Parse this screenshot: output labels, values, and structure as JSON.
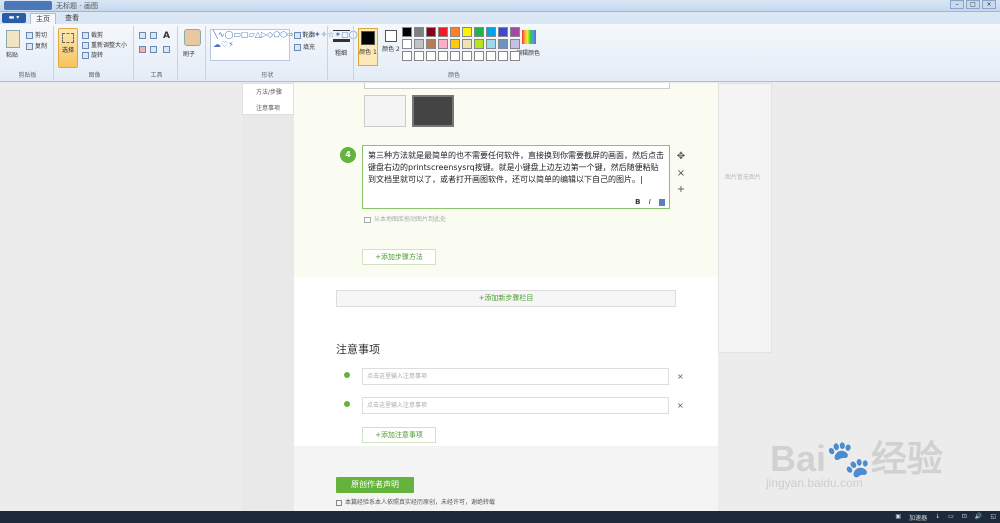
{
  "window": {
    "title": "无标题 - 画图"
  },
  "tabs": {
    "file": "▬ ▾",
    "home": "主页",
    "view": "查看"
  },
  "ribbon": {
    "clipboard": {
      "paste": "粘贴",
      "cut": "剪切",
      "copy": "复制",
      "label": "剪贴板"
    },
    "image": {
      "select": "选择",
      "crop": "裁剪",
      "resize": "重新调整大小",
      "rotate": "旋转",
      "label": "图像"
    },
    "tools": {
      "label": "工具",
      "text": "A"
    },
    "brushes": {
      "label": "刷子"
    },
    "shapes": {
      "outline": "轮廓",
      "fill": "填充",
      "label": "形状"
    },
    "size": {
      "label": "粗细"
    },
    "colors": {
      "color1": "颜色 1",
      "color2": "颜色 2",
      "edit": "编辑颜色",
      "label": "颜色",
      "palette": [
        "#000000",
        "#7f7f7f",
        "#880015",
        "#ed1c24",
        "#ff7f27",
        "#fff200",
        "#22b14c",
        "#00a2e8",
        "#3f48cc",
        "#a349a4",
        "#ffffff",
        "#c3c3c3",
        "#b97a57",
        "#ffaec9",
        "#ffc90e",
        "#efe4b0",
        "#b5e61d",
        "#99d9ea",
        "#7092be",
        "#c8bfe7",
        "#ffffff",
        "#ffffff",
        "#ffffff",
        "#ffffff",
        "#ffffff",
        "#ffffff",
        "#ffffff",
        "#ffffff",
        "#ffffff",
        "#ffffff"
      ]
    }
  },
  "sidebar": {
    "items": [
      "方法/步骤",
      "注意事项"
    ]
  },
  "step": {
    "number": "4",
    "text": "第三种方法就是最简单的也不需要任何软件，直接换到你需要截屏的画面，然后点击键盘右边的printscreensysrq按键。就是小键盘上边左边第一个键，然后随便粘贴到文档里就可以了，或者打开画图软件，还可以简单的编辑以下自己的图片。|",
    "bold": "B",
    "italic": "I",
    "upload_hint": "从本地图库拖动图片到此处"
  },
  "controls": {
    "move": "✥",
    "close": "×",
    "add": "+"
  },
  "buttons": {
    "add_step": "+添加步骤方法",
    "add_section": "+添加新步骤栏目",
    "add_note": "+添加注意事项",
    "original": "原创作者声明"
  },
  "notes": {
    "title": "注意事项",
    "placeholder": "点击这里输入注意事项",
    "close": "×"
  },
  "declaration": "本篇经验系本人依照真实经历原创，未经许可，谢绝转载",
  "right_panel": {
    "hint": "图片暂无图片"
  },
  "watermark": {
    "logo": "Bai🐾经验",
    "url": "jingyan.baidu.com"
  },
  "taskbar": {
    "items": [
      "▣",
      "加速器",
      "↓",
      "▭",
      "⊡",
      "🔊",
      "◱"
    ]
  }
}
